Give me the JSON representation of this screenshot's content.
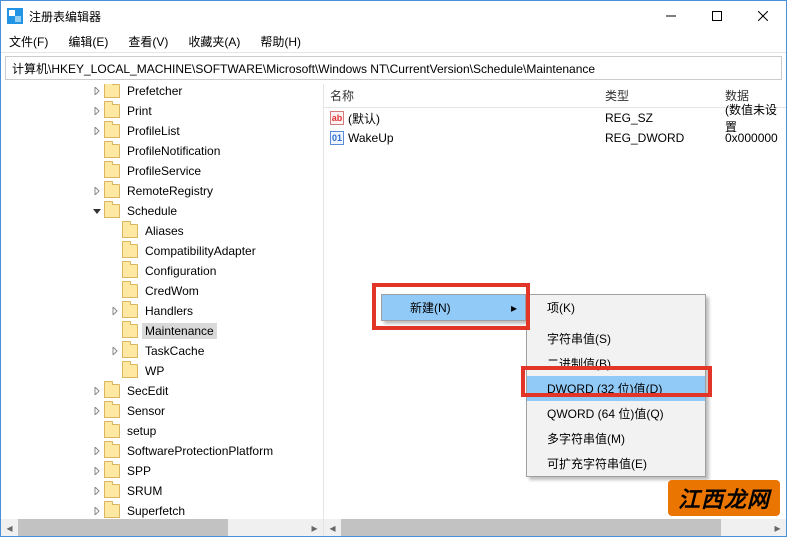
{
  "window": {
    "title": "注册表编辑器"
  },
  "menus": {
    "file": "文件(F)",
    "edit": "编辑(E)",
    "view": "查看(V)",
    "fav": "收藏夹(A)",
    "help": "帮助(H)"
  },
  "address": "计算机\\HKEY_LOCAL_MACHINE\\SOFTWARE\\Microsoft\\Windows NT\\CurrentVersion\\Schedule\\Maintenance",
  "tree": [
    {
      "indent": 5,
      "tw": ">",
      "label": "Prefetcher"
    },
    {
      "indent": 5,
      "tw": ">",
      "label": "Print"
    },
    {
      "indent": 5,
      "tw": ">",
      "label": "ProfileList"
    },
    {
      "indent": 5,
      "tw": "",
      "label": "ProfileNotification"
    },
    {
      "indent": 5,
      "tw": "",
      "label": "ProfileService"
    },
    {
      "indent": 5,
      "tw": ">",
      "label": "RemoteRegistry"
    },
    {
      "indent": 5,
      "tw": "v",
      "label": "Schedule"
    },
    {
      "indent": 6,
      "tw": "",
      "label": "Aliases"
    },
    {
      "indent": 6,
      "tw": "",
      "label": "CompatibilityAdapter"
    },
    {
      "indent": 6,
      "tw": "",
      "label": "Configuration"
    },
    {
      "indent": 6,
      "tw": "",
      "label": "CredWom"
    },
    {
      "indent": 6,
      "tw": ">",
      "label": "Handlers"
    },
    {
      "indent": 6,
      "tw": "",
      "label": "Maintenance",
      "sel": true
    },
    {
      "indent": 6,
      "tw": ">",
      "label": "TaskCache"
    },
    {
      "indent": 6,
      "tw": "",
      "label": "WP"
    },
    {
      "indent": 5,
      "tw": ">",
      "label": "SecEdit"
    },
    {
      "indent": 5,
      "tw": ">",
      "label": "Sensor"
    },
    {
      "indent": 5,
      "tw": "",
      "label": "setup"
    },
    {
      "indent": 5,
      "tw": ">",
      "label": "SoftwareProtectionPlatform"
    },
    {
      "indent": 5,
      "tw": ">",
      "label": "SPP"
    },
    {
      "indent": 5,
      "tw": ">",
      "label": "SRUM"
    },
    {
      "indent": 5,
      "tw": ">",
      "label": "Superfetch"
    }
  ],
  "list": {
    "cols": {
      "name": "名称",
      "type": "类型",
      "data": "数据"
    },
    "rows": [
      {
        "icon": "str",
        "name": "(默认)",
        "type": "REG_SZ",
        "data": "(数值未设置"
      },
      {
        "icon": "bin",
        "name": "WakeUp",
        "type": "REG_DWORD",
        "data": "0x000000"
      }
    ]
  },
  "ctx1": {
    "new": "新建(N)"
  },
  "ctx2": {
    "key": "项(K)",
    "string": "字符串值(S)",
    "binary": "二进制值(B)",
    "dword": "DWORD (32 位)值(D)",
    "qword": "QWORD (64 位)值(Q)",
    "multi": "多字符串值(M)",
    "expand": "可扩充字符串值(E)"
  },
  "watermark": "江西龙网"
}
